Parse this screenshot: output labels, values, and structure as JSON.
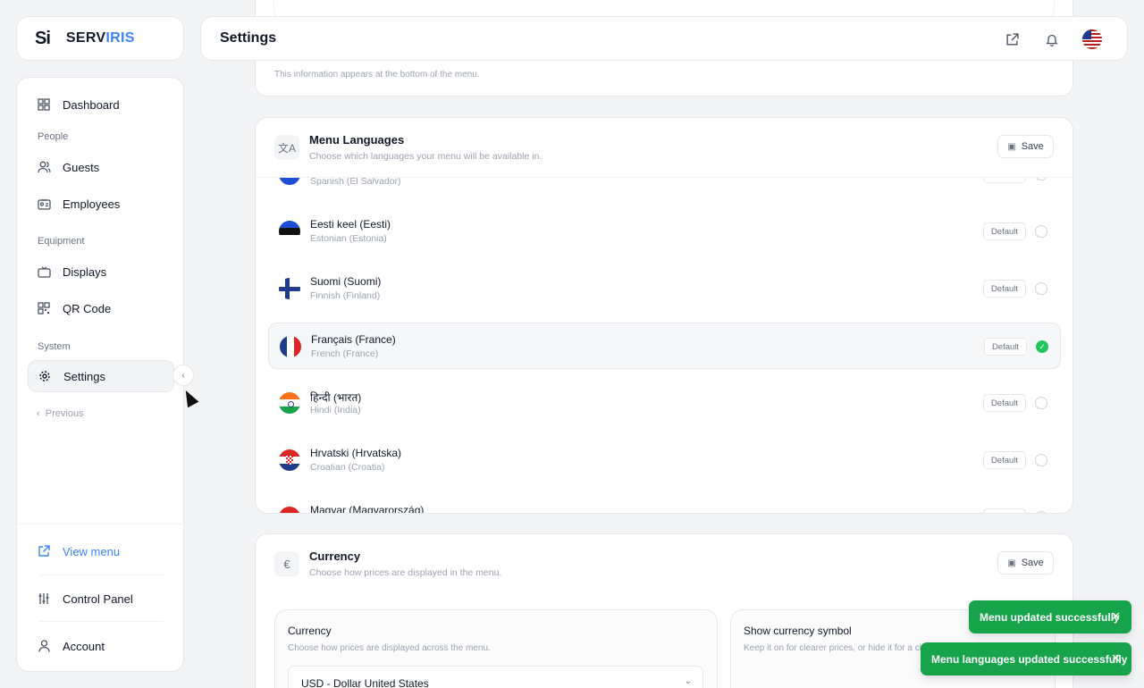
{
  "brand": {
    "mark": "Si",
    "name_part1": "SERV",
    "name_part2": "IRIS"
  },
  "sidebar": {
    "items": [
      {
        "label": "Dashboard",
        "icon": "grid-icon"
      },
      {
        "label": "Guests",
        "icon": "users-icon"
      },
      {
        "label": "Employees",
        "icon": "id-card-icon"
      },
      {
        "label": "Displays",
        "icon": "tv-icon"
      },
      {
        "label": "QR Code",
        "icon": "qr-icon"
      },
      {
        "label": "Settings",
        "icon": "gear-icon",
        "active": true
      }
    ],
    "sections": [
      "People",
      "Equipment",
      "System"
    ],
    "previous_label": "Previous",
    "bottom": [
      {
        "label": "View menu",
        "icon": "external-link-icon",
        "color": "#3b82f6"
      },
      {
        "label": "Control Panel",
        "icon": "sliders-icon"
      },
      {
        "label": "Account",
        "icon": "user-icon"
      }
    ]
  },
  "header": {
    "title": "Settings",
    "icons": [
      "external-link-icon",
      "bell-icon",
      "us-flag-icon"
    ]
  },
  "info_card": {
    "hint": "This information appears at the bottom of the menu."
  },
  "languages": {
    "title": "Menu Languages",
    "subtitle": "Choose which languages your menu will be available in.",
    "save_label": "Save",
    "default_label": "Default",
    "rows": [
      {
        "native": "",
        "english": "Spanish (El Salvador)",
        "flag": "sv"
      },
      {
        "native": "Eesti keel (Eesti)",
        "english": "Estonian (Estonia)",
        "flag": "ee"
      },
      {
        "native": "Suomi (Suomi)",
        "english": "Finnish (Finland)",
        "flag": "fi"
      },
      {
        "native": "Français (France)",
        "english": "French (France)",
        "flag": "fr",
        "selected": true
      },
      {
        "native": "हिन्दी (भारत)",
        "english": "Hindi (India)",
        "flag": "in"
      },
      {
        "native": "Hrvatski (Hrvatska)",
        "english": "Croatian (Croatia)",
        "flag": "hr"
      },
      {
        "native": "Magyar (Magyarország)",
        "english": "",
        "flag": "hu"
      }
    ]
  },
  "currency": {
    "title": "Currency",
    "subtitle": "Choose how prices are displayed in the menu.",
    "save_label": "Save",
    "icon": "€",
    "box_currency": {
      "title": "Currency",
      "subtitle": "Choose how prices are displayed across the menu.",
      "value": "USD - Dollar United States"
    },
    "box_symbol": {
      "title": "Show currency symbol",
      "subtitle": "Keep it on for clearer prices, or hide it for a cle"
    }
  },
  "toasts": [
    {
      "text": "Menu updated successfully"
    },
    {
      "text": "Menu languages updated successfully"
    }
  ],
  "colors": {
    "accent": "#3b82f6",
    "success": "#16a34a",
    "check": "#22c55e"
  }
}
